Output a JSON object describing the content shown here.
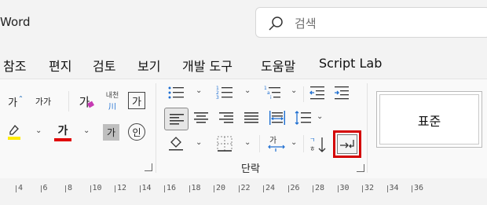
{
  "app": {
    "title": "Word"
  },
  "search": {
    "placeholder": "검색"
  },
  "menu": {
    "items": [
      "참조",
      "편지",
      "검토",
      "보기",
      "개발 도구",
      "도움말",
      "Script Lab"
    ]
  },
  "font_group": {
    "grow_label": "가",
    "shrink_label": "가가",
    "clear_label": "가",
    "phonetic_label": "내천",
    "phonetic_sub": "川",
    "char_border_label": "가",
    "font_color_label": "가",
    "char_shading_label": "가",
    "enclose_label": "인",
    "highlight_color": "#ffeb00",
    "font_color": "#e00000"
  },
  "paragraph_group": {
    "label": "단락"
  },
  "styles": {
    "normal_label": "표준"
  },
  "ruler": {
    "labels": [
      "4",
      "6",
      "8",
      "10",
      "12",
      "14",
      "16",
      "18",
      "20",
      "22",
      "24",
      "26",
      "28",
      "30",
      "32",
      "34",
      "36"
    ]
  },
  "colors": {
    "accent_red": "#d40000",
    "selected_bg": "#e6e6e6"
  }
}
